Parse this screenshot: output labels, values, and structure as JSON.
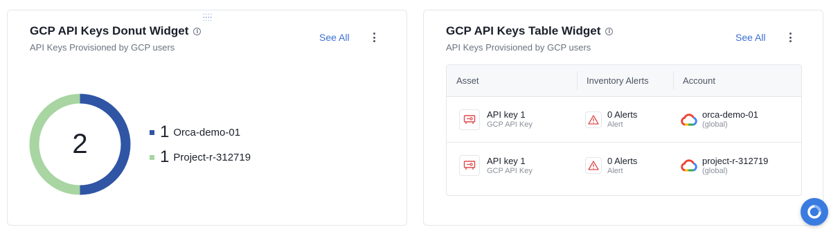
{
  "donut_widget": {
    "title": "GCP API Keys Donut Widget",
    "info_icon": "info-icon",
    "subtitle": "API Keys Provisioned by GCP users",
    "see_all": "See All",
    "total": "2",
    "colors": {
      "orca": "#2f55a4",
      "project": "#a8d5a2"
    },
    "legend": [
      {
        "count": "1",
        "name": "Orca-demo-01",
        "color": "#2f55a4"
      },
      {
        "count": "1",
        "name": "Project-r-312719",
        "color": "#a8d5a2"
      }
    ],
    "chart_data": {
      "type": "pie",
      "categories": [
        "Orca-demo-01",
        "Project-r-312719"
      ],
      "values": [
        1,
        1
      ]
    }
  },
  "table_widget": {
    "title": "GCP API Keys Table Widget",
    "info_icon": "info-icon",
    "subtitle": "API Keys Provisioned by GCP users",
    "see_all": "See All",
    "columns": [
      "Asset",
      "Inventory Alerts",
      "Account"
    ],
    "rows": [
      {
        "asset": "API key 1",
        "asset_type": "GCP API Key",
        "alerts": "0 Alerts",
        "alerts_sub": "Alert",
        "account": "orca-demo-01",
        "account_sub": "(global)"
      },
      {
        "asset": "API key 1",
        "asset_type": "GCP API Key",
        "alerts": "0 Alerts",
        "alerts_sub": "Alert",
        "account": "project-r-312719",
        "account_sub": "(global)"
      }
    ]
  },
  "accent_color": "#3b6fd4",
  "fab_icon": "chat-assistant-icon"
}
